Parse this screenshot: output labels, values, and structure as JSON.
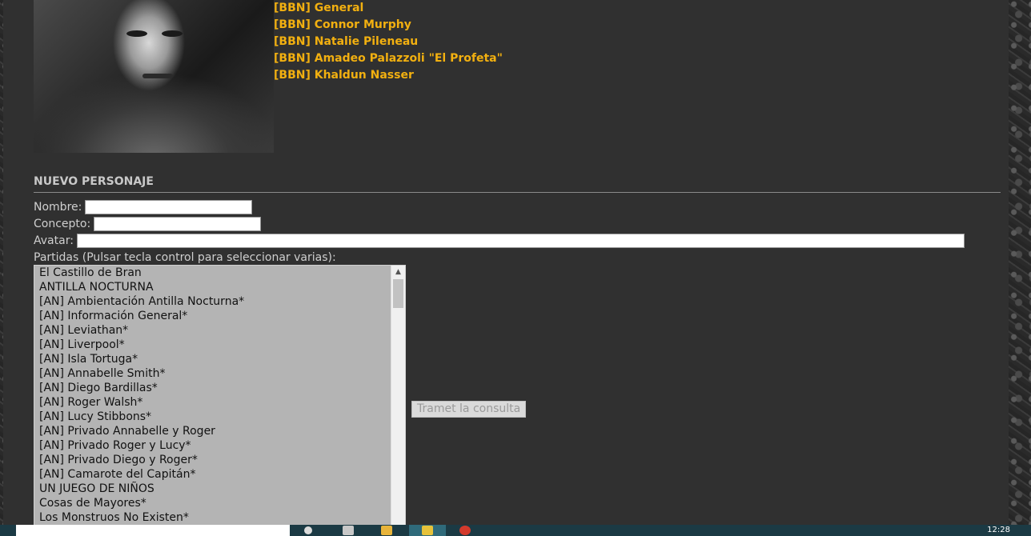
{
  "characters": [
    "[BBN] General",
    "[BBN] Connor Murphy",
    "[BBN] Natalie Pileneau",
    "[BBN] Amadeo Palazzoli \"El Profeta\"",
    "[BBN] Khaldun Nasser"
  ],
  "form": {
    "section_title": "NUEVO PERSONAJE",
    "nombre_label": "Nombre:",
    "concepto_label": "Concepto:",
    "avatar_label": "Avatar:",
    "partidas_label": "Partidas (Pulsar tecla control para seleccionar varias):",
    "submit_label": "Tramet la consulta"
  },
  "partidas": [
    "El Castillo de Bran",
    "ANTILLA NOCTURNA",
    "[AN] Ambientación Antilla Nocturna*",
    "[AN] Información General*",
    "[AN] Leviathan*",
    "[AN] Liverpool*",
    "[AN] Isla Tortuga*",
    "[AN] Annabelle Smith*",
    "[AN] Diego Bardillas*",
    "[AN] Roger Walsh*",
    "[AN] Lucy Stibbons*",
    "[AN] Privado Annabelle y Roger",
    "[AN] Privado Roger y Lucy*",
    "[AN] Privado Diego y Roger*",
    "[AN] Camarote del Capitán*",
    "UN JUEGO DE NIÑOS",
    "Cosas de Mayores*",
    "Los Monstruos No Existen*"
  ],
  "taskbar": {
    "clock": "12:28"
  }
}
